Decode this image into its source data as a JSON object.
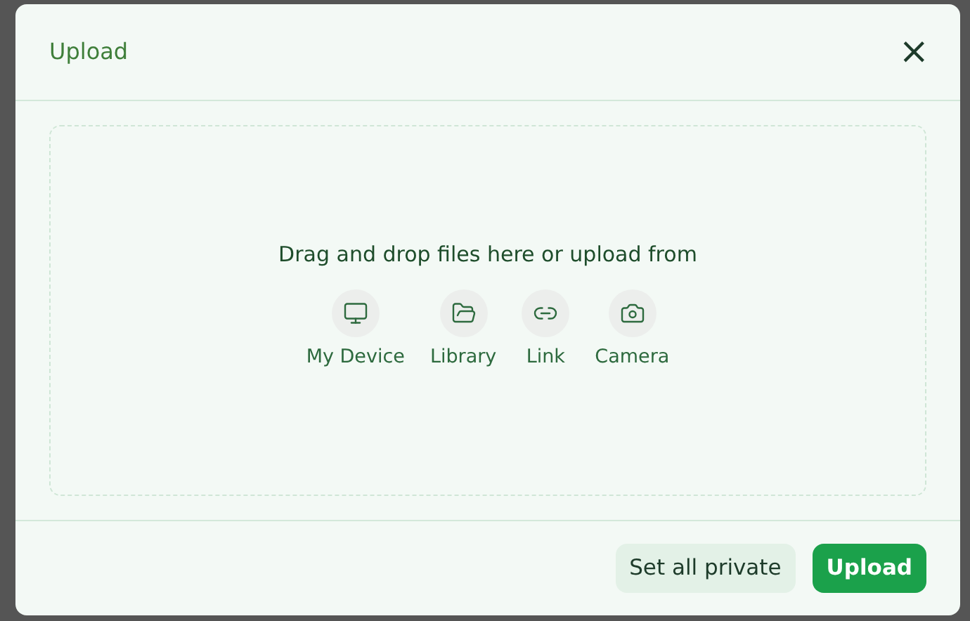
{
  "dialog": {
    "title": "Upload",
    "close": "×"
  },
  "dropzone": {
    "prompt": "Drag and drop files here or upload from",
    "sources": [
      {
        "kind": "device",
        "label": "My Device"
      },
      {
        "kind": "library",
        "label": "Library"
      },
      {
        "kind": "link",
        "label": "Link"
      },
      {
        "kind": "camera",
        "label": "Camera"
      }
    ]
  },
  "buttons": [
    {
      "label": "Set all private",
      "primary": false
    },
    {
      "label": "Upload",
      "primary": true
    }
  ]
}
